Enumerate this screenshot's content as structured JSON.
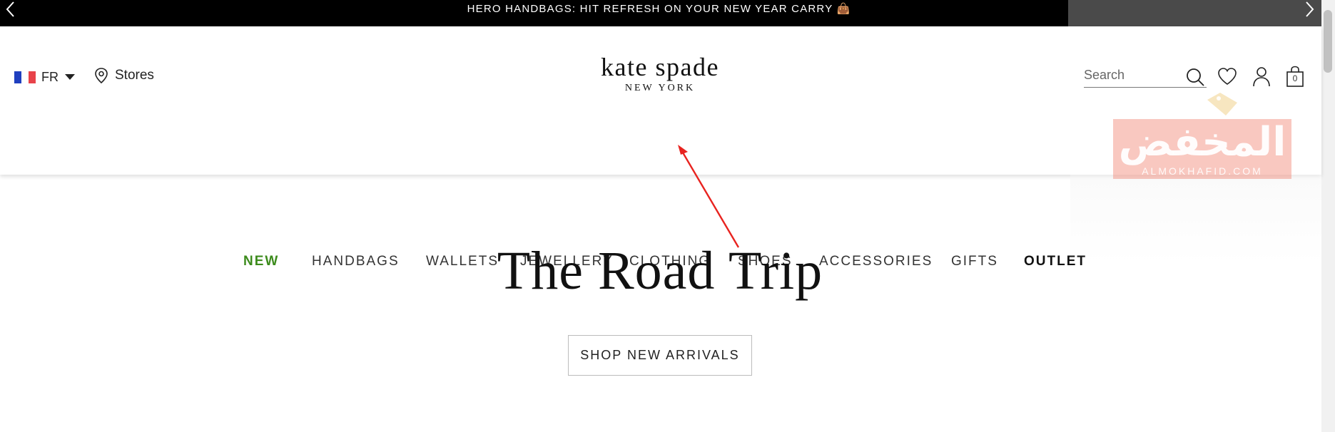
{
  "announcement": {
    "text": "HERO HANDBAGS: HIT REFRESH ON YOUR NEW YEAR CARRY 👜",
    "prev_icon": "chevron-left-icon",
    "next_icon": "chevron-right-icon"
  },
  "header": {
    "locale": {
      "code": "FR",
      "flag_colors": [
        "#1f3fbf",
        "#ffffff",
        "#e8434a"
      ]
    },
    "stores_label": "Stores",
    "logo": {
      "main": "kate spade",
      "sub": "NEW YORK"
    },
    "search": {
      "placeholder": "Search",
      "value": ""
    },
    "bag_count": "0",
    "icons": [
      "search-icon",
      "heart-icon",
      "account-icon",
      "shopping-bag-icon"
    ]
  },
  "nav": {
    "items": [
      {
        "label": "NEW"
      },
      {
        "label": "HANDBAGS"
      },
      {
        "label": "WALLETS"
      },
      {
        "label": "JEWELLERY"
      },
      {
        "label": "CLOTHING"
      },
      {
        "label": "SHOES"
      },
      {
        "label": "ACCESSORIES"
      },
      {
        "label": "GIFTS"
      },
      {
        "label": "OUTLET"
      }
    ],
    "accent_color": "#3c8b1c"
  },
  "watermark": {
    "text": "المخفض",
    "sub": "ALMOKHAFID.COM"
  },
  "hero": {
    "title": "The Road Trip",
    "cta_label": "SHOP NEW ARRIVALS"
  },
  "annotation": {
    "color": "#e8231f",
    "points_to": "CLOTHING"
  }
}
